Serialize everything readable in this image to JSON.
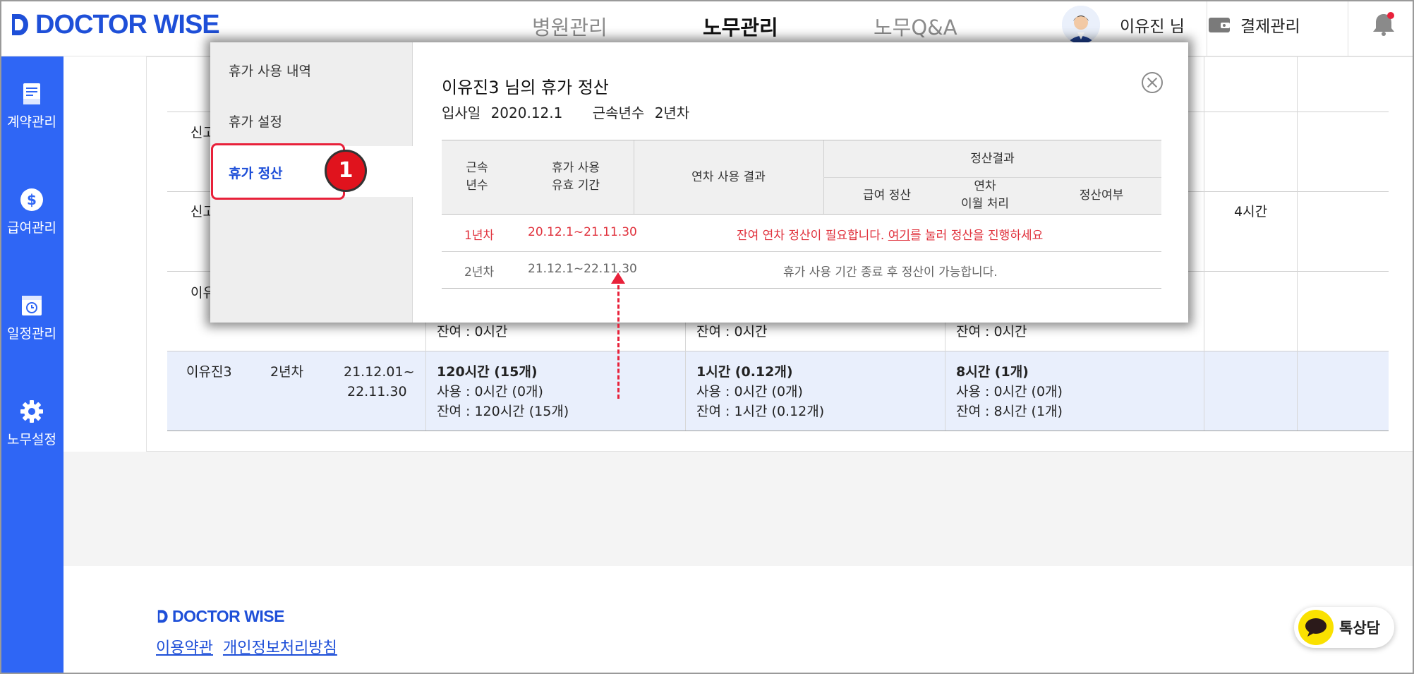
{
  "header": {
    "logo_text": "DOCTOR WISE",
    "nav": [
      "병원관리",
      "노무관리",
      "노무Q&A"
    ],
    "user_name": "이유진 님",
    "payment_label": "결제관리",
    "accent": "#1e4fd8"
  },
  "sidebar": {
    "items": [
      {
        "label": "계약관리",
        "icon": "contract-icon"
      },
      {
        "label": "급여관리",
        "icon": "dollar-icon"
      },
      {
        "label": "일정관리",
        "icon": "calendar-clock-icon"
      },
      {
        "label": "노무설정",
        "icon": "gear-icon"
      }
    ],
    "color": "#2f66f5"
  },
  "background_table": {
    "partial_cells": [
      "신고",
      "신고",
      "이유"
    ],
    "row_4h": "4시간",
    "residual_row": [
      "잔여 : 0시간",
      "잔여 : 0시간",
      "잔여 : 0시간"
    ],
    "highlighted_row": {
      "name": "이유진3",
      "year": "2년차",
      "period": [
        "21.12.01~",
        "22.11.30"
      ],
      "annual": [
        "120시간 (15개)",
        "사용 : 0시간 (0개)",
        "잔여 : 120시간 (15개)"
      ],
      "monthly": [
        "1시간 (0.12개)",
        "사용 : 0시간 (0개)",
        "잔여 : 1시간 (0.12개)"
      ],
      "special": [
        "8시간 (1개)",
        "사용 : 0시간 (0개)",
        "잔여 : 8시간 (1개)"
      ]
    }
  },
  "modal": {
    "menu": [
      "휴가 사용 내역",
      "휴가 설정",
      "휴가 정산"
    ],
    "active_menu": "휴가 정산",
    "step_badge": "1",
    "title": "이유진3 님의 휴가 정산",
    "join_label": "입사일",
    "join_date": "2020.12.1",
    "tenure_label": "근속년수",
    "tenure_value": "2년차",
    "table": {
      "headers": {
        "tenure": [
          "근속",
          "년수"
        ],
        "period": [
          "휴가 사용",
          "유효 기간"
        ],
        "result": "연차 사용 결과",
        "settlement": "정산결과",
        "pay": "급여 정산",
        "carry": [
          "연차",
          "이월 처리"
        ],
        "done": "정산여부"
      },
      "rows": [
        {
          "year": "1년차",
          "period": "20.12.1~21.11.30",
          "message_pre": "잔여 연차 정산이 필요합니다. ",
          "message_link": "여기",
          "message_post": "를 눌러 정산을 진행하세요",
          "status": "red"
        },
        {
          "year": "2년차",
          "period": "21.12.1~22.11.30",
          "message": "휴가 사용 기간 종료 후 정산이 가능합니다.",
          "status": "grey"
        }
      ]
    }
  },
  "footer": {
    "logo_text": "DOCTOR WISE",
    "links": [
      "이용약관",
      "개인정보처리방침"
    ],
    "chat_label": "톡상담"
  }
}
